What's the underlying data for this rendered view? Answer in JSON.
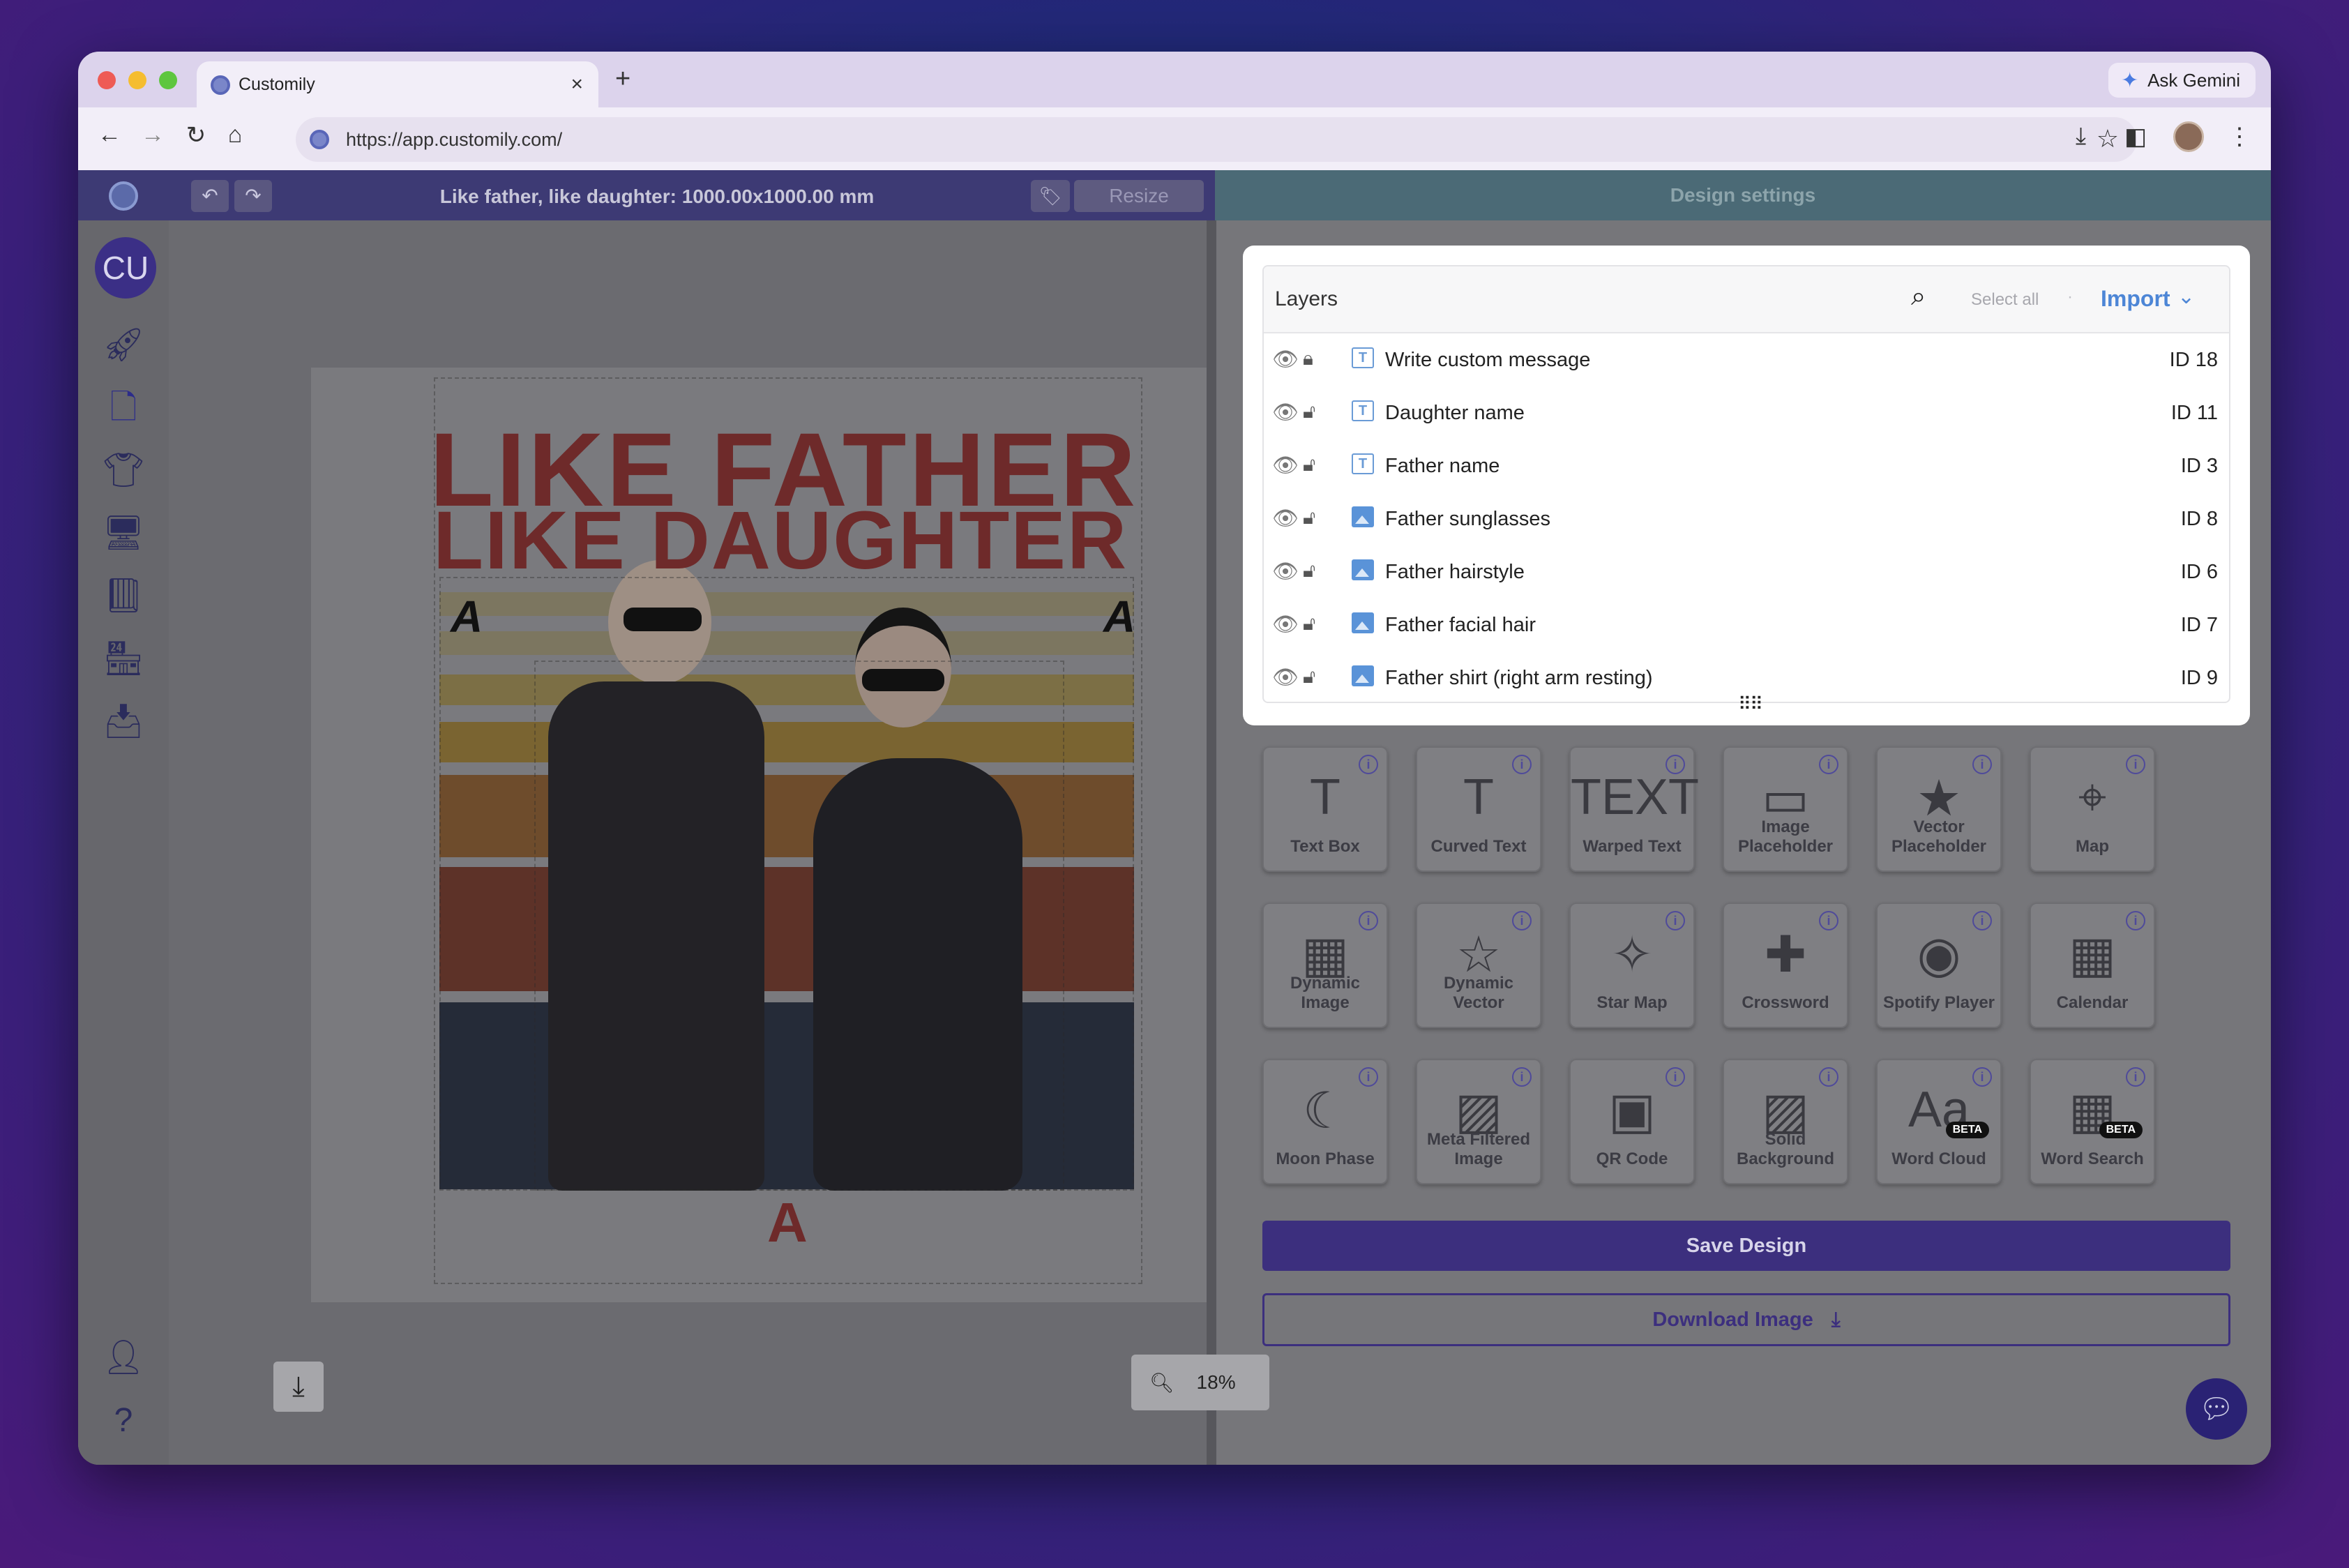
{
  "browser": {
    "tab_title": "Customily",
    "new_tab": "+",
    "close": "×",
    "gemini_label": "Ask Gemini",
    "url": "https://app.customily.com/"
  },
  "app": {
    "doc_title": "Like father, like daughter: 1000.00x1000.00 mm",
    "resize_label": "Resize",
    "design_settings": "Design settings",
    "avatar_initials": "CU",
    "zoom_value": "18%"
  },
  "artwork": {
    "title_line1": "LIKE FATHER",
    "title_line2": "LIKE DAUGHTER",
    "letter_left": "A",
    "letter_right": "A",
    "letter_bottom": "A"
  },
  "layers": {
    "header": "Layers",
    "select_all": "Select all",
    "separator": "·",
    "import": "Import",
    "items": [
      {
        "name": "Write custom message",
        "id": "ID 18",
        "type": "text",
        "locked": true
      },
      {
        "name": "Daughter name",
        "id": "ID 11",
        "type": "text",
        "locked": false
      },
      {
        "name": "Father name",
        "id": "ID 3",
        "type": "text",
        "locked": false
      },
      {
        "name": "Father sunglasses",
        "id": "ID 8",
        "type": "image",
        "locked": false
      },
      {
        "name": "Father hairstyle",
        "id": "ID 6",
        "type": "image",
        "locked": false
      },
      {
        "name": "Father facial hair",
        "id": "ID 7",
        "type": "image",
        "locked": false
      },
      {
        "name": "Father shirt (right arm resting)",
        "id": "ID 9",
        "type": "image",
        "locked": false
      }
    ]
  },
  "elements": [
    {
      "label": "Text Box",
      "icon": "T"
    },
    {
      "label": "Curved Text",
      "icon": "T"
    },
    {
      "label": "Warped Text",
      "icon": "TEXT"
    },
    {
      "label": "Image Placeholder",
      "icon": "▭"
    },
    {
      "label": "Vector Placeholder",
      "icon": "★"
    },
    {
      "label": "Map",
      "icon": "⌖"
    },
    {
      "label": "Dynamic Image",
      "icon": "▦"
    },
    {
      "label": "Dynamic Vector",
      "icon": "☆"
    },
    {
      "label": "Star Map",
      "icon": "✧"
    },
    {
      "label": "Crossword",
      "icon": "✚"
    },
    {
      "label": "Spotify Player",
      "icon": "◉"
    },
    {
      "label": "Calendar",
      "icon": "▦"
    },
    {
      "label": "Moon Phase",
      "icon": "☾"
    },
    {
      "label": "Meta Filtered Image",
      "icon": "▨"
    },
    {
      "label": "QR Code",
      "icon": "▣"
    },
    {
      "label": "Solid Background",
      "icon": "▨"
    },
    {
      "label": "Word Cloud",
      "icon": "Aa",
      "badge": "BETA"
    },
    {
      "label": "Word Search",
      "icon": "▦",
      "badge": "BETA"
    }
  ],
  "actions": {
    "save": "Save Design",
    "download": "Download Image"
  }
}
